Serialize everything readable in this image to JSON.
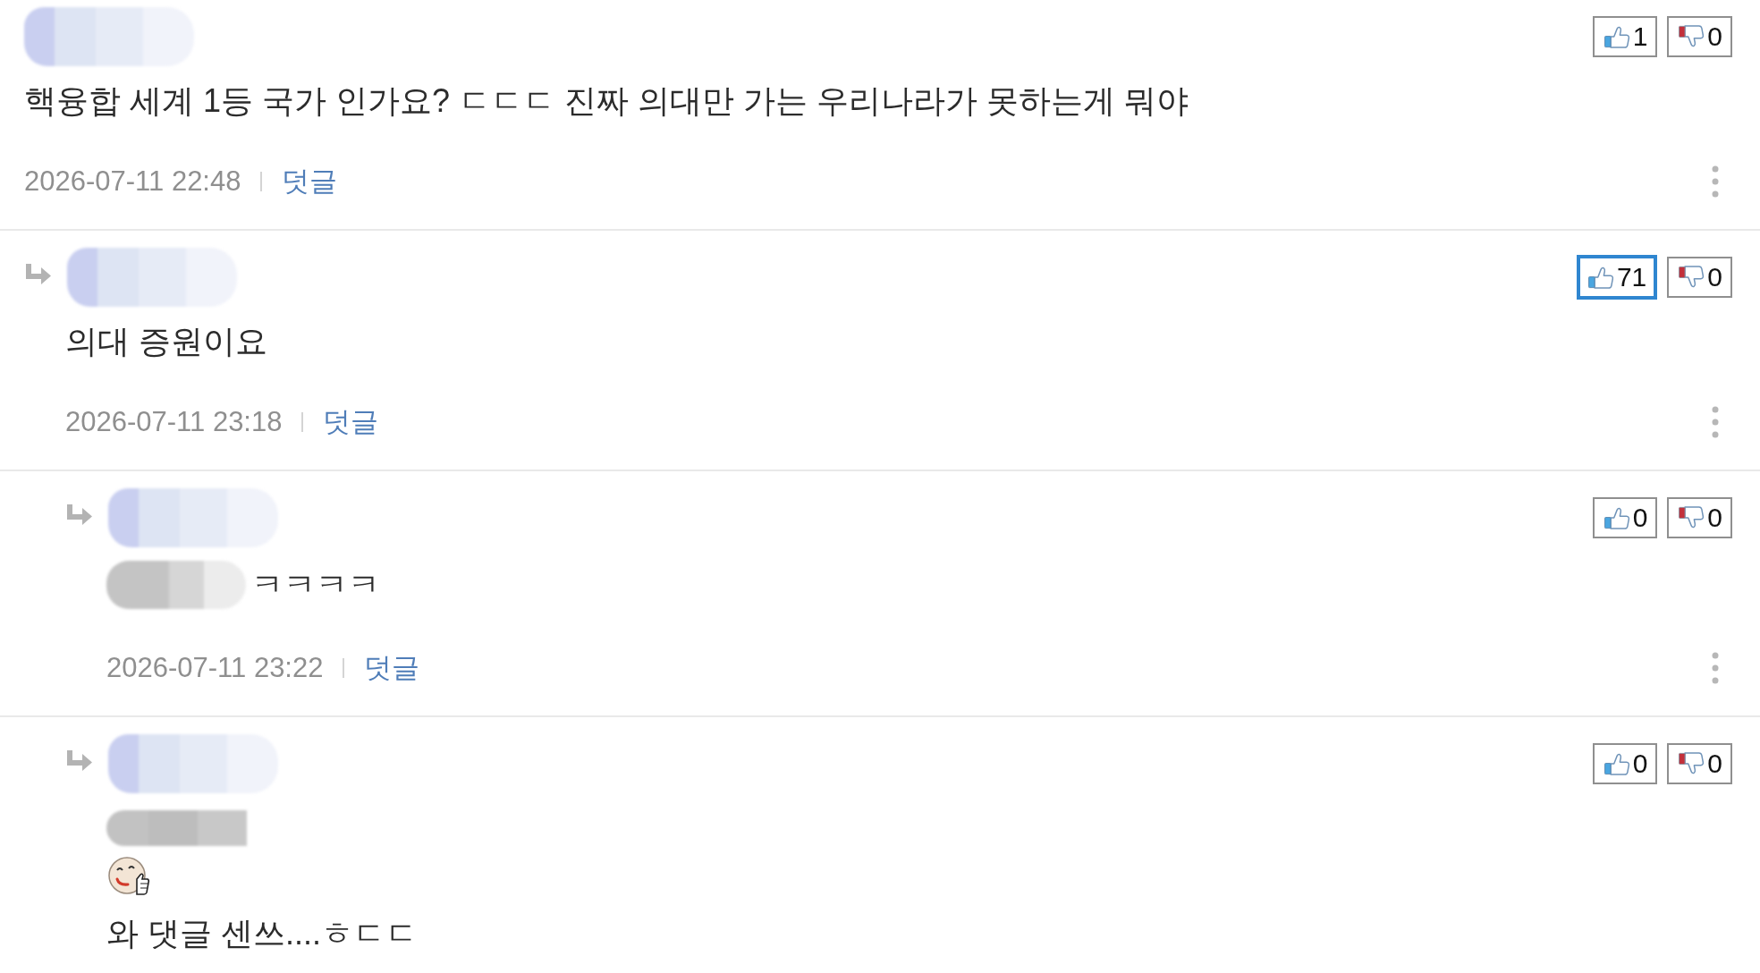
{
  "comments": [
    {
      "likes": {
        "count": "1",
        "selected": false
      },
      "dislikes": {
        "count": "0",
        "selected": false
      },
      "body": [
        {
          "kind": "text",
          "text": "핵융합 세계 1등 국가 인가요? ㄷㄷㄷ 진짜 의대만 가는 우리나라가 못하는게 뭐야",
          "redacted_prefix": false
        }
      ],
      "date": "2026-07-11 22:48",
      "reply_link": "덧글",
      "children": [
        {
          "likes": {
            "count": "71",
            "selected": true
          },
          "dislikes": {
            "count": "0",
            "selected": false
          },
          "body": [
            {
              "kind": "text",
              "text": "의대 증원이요",
              "redacted_prefix": false
            }
          ],
          "date": "2026-07-11 23:18",
          "reply_link": "덧글",
          "children": [
            {
              "likes": {
                "count": "0",
                "selected": false
              },
              "dislikes": {
                "count": "0",
                "selected": false
              },
              "body": [
                {
                  "kind": "text",
                  "text": "ㅋㅋㅋㅋ",
                  "redacted_prefix": true
                }
              ],
              "date": "2026-07-11 23:22",
              "reply_link": "덧글"
            },
            {
              "likes": {
                "count": "0",
                "selected": false
              },
              "dislikes": {
                "count": "0",
                "selected": false
              },
              "body": [
                {
                  "kind": "redacted"
                },
                {
                  "kind": "emoticon"
                },
                {
                  "kind": "text",
                  "text": "와 댓글 센쓰....ㅎㄷㄷ",
                  "redacted_prefix": false
                }
              ]
            }
          ]
        }
      ]
    }
  ]
}
